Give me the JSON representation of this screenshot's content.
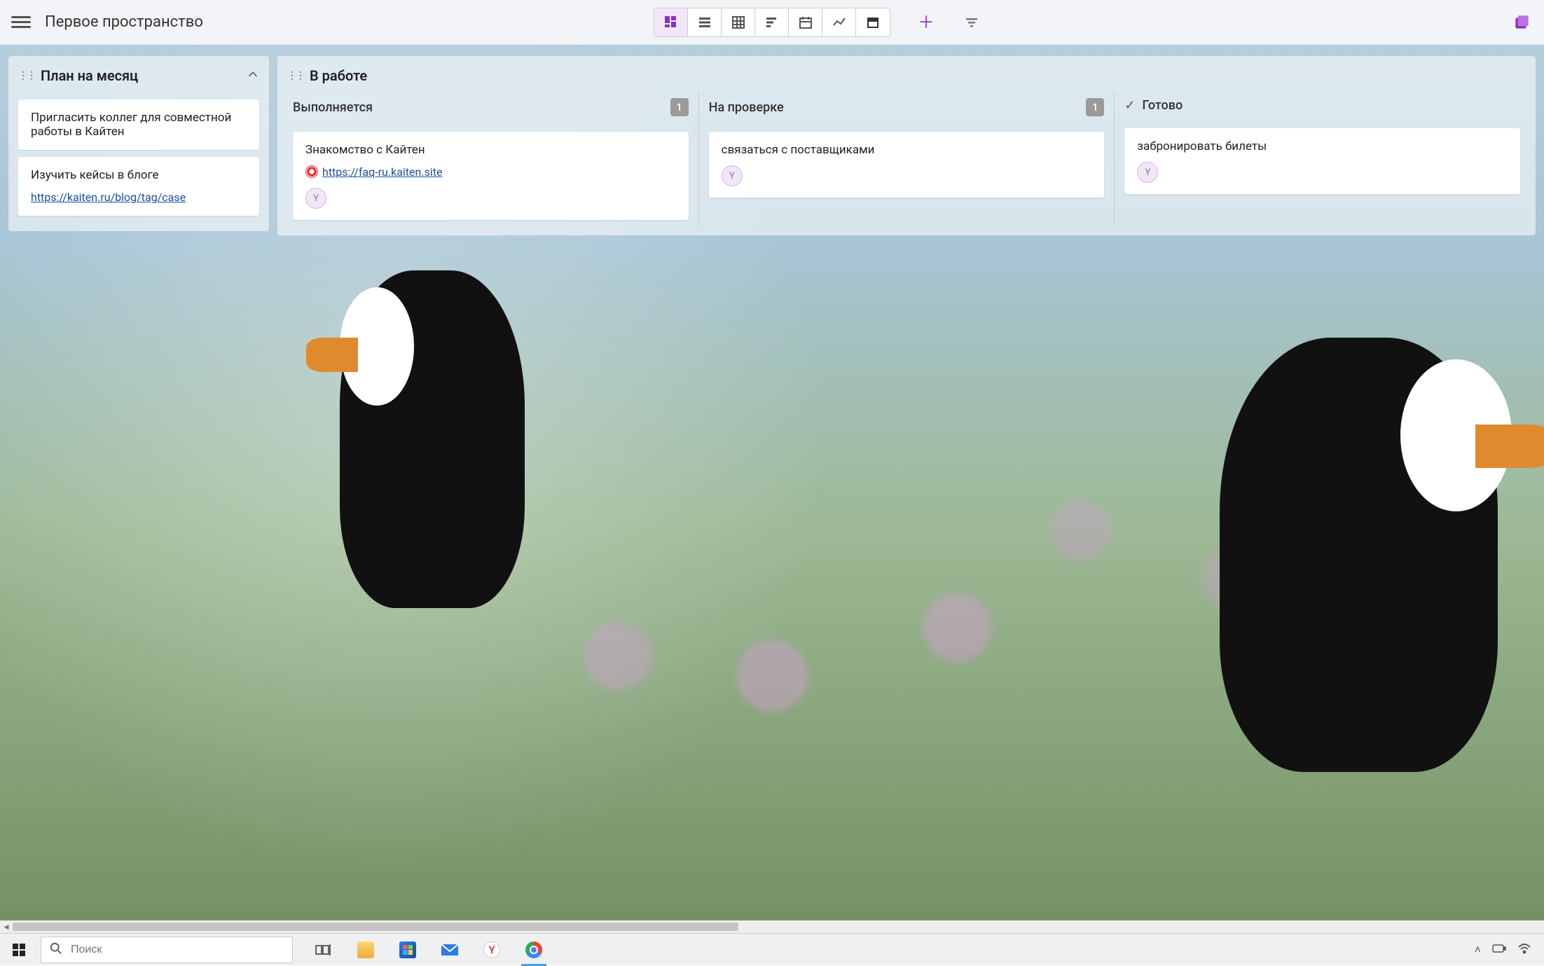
{
  "header": {
    "title": "Первое пространство"
  },
  "viewModes": {
    "board": "board-view",
    "list": "list-view",
    "table": "table-view",
    "gantt": "gantt-view",
    "calendar": "calendar-view",
    "chart": "chart-view",
    "archive": "archive-view"
  },
  "boards": {
    "plan": {
      "title": "План на месяц",
      "cards": [
        {
          "title": "Пригласить коллег для совместной работы в Кайтен"
        },
        {
          "title": "Изучить кейсы в блоге",
          "link": "https://kaiten.ru/blog/tag/case"
        }
      ]
    },
    "work": {
      "title": "В работе",
      "columns": [
        {
          "name": "Выполняется",
          "count": "1",
          "cards": [
            {
              "title": "Знакомство с Кайтен",
              "link": "https://faq-ru.kaiten.site",
              "avatar": "Y",
              "linkIcon": true
            }
          ]
        },
        {
          "name": "На проверке",
          "count": "1",
          "cards": [
            {
              "title": "связаться с поставщиками",
              "avatar": "Y"
            }
          ]
        },
        {
          "name": "Готово",
          "done": true,
          "cards": [
            {
              "title": "забронировать билеты",
              "avatar": "Y"
            }
          ]
        }
      ]
    }
  },
  "taskbar": {
    "searchPlaceholder": "Поиск"
  },
  "colors": {
    "accent": "#8b2fc9"
  }
}
